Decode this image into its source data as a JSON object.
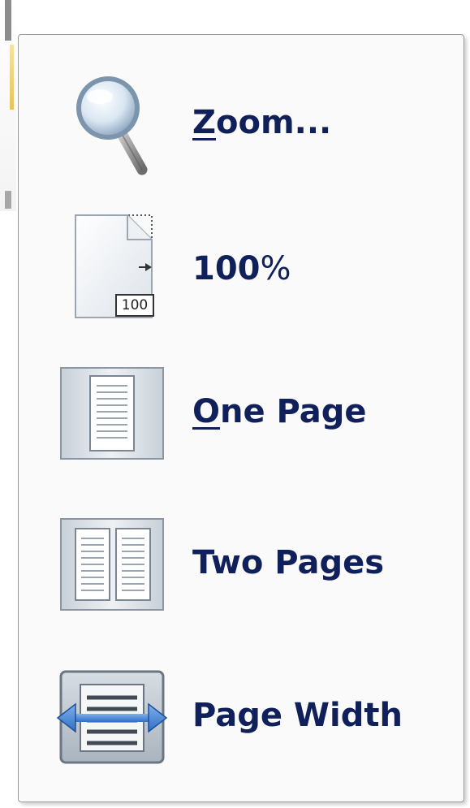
{
  "menu": {
    "items": [
      {
        "id": "zoom",
        "label_first": "Z",
        "label_rest": "oom...",
        "icon": "magnifier-icon"
      },
      {
        "id": "hundred",
        "label_main": "100",
        "label_suffix": "%",
        "icon": "page-100-icon"
      },
      {
        "id": "one-page",
        "label_first": "O",
        "label_rest": "ne Page",
        "icon": "one-page-icon"
      },
      {
        "id": "two-pages",
        "label": "Two Pages",
        "icon": "two-pages-icon"
      },
      {
        "id": "page-width",
        "label": "Page Width",
        "icon": "page-width-icon"
      }
    ],
    "badge_100": "100"
  },
  "colors": {
    "label": "#10205a",
    "menu_bg": "#fafafa",
    "border": "#9a9a9a",
    "accent_blue": "#2f6fc6"
  }
}
